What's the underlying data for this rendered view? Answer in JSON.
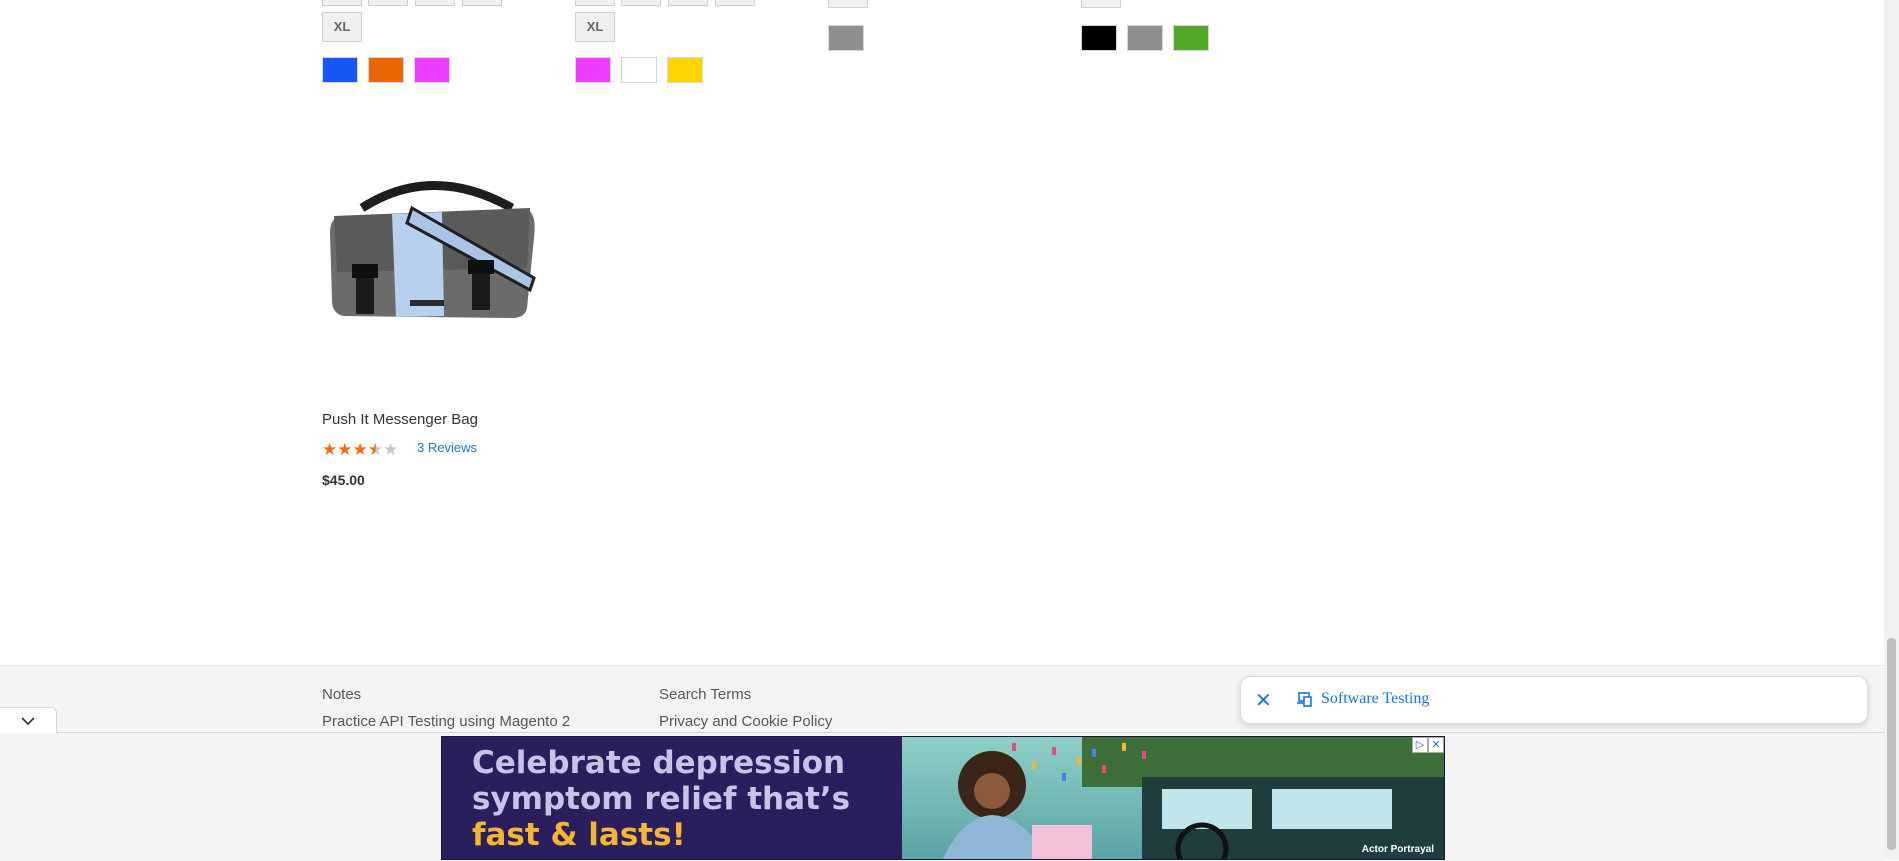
{
  "products_row1": {
    "col1": {
      "size_label": "XL",
      "colors": [
        "#1857f7",
        "#eb6703",
        "#ef3dff"
      ]
    },
    "col2": {
      "size_label": "XL",
      "colors": [
        "#ef3dff",
        "#ffffff",
        "#ffd500"
      ]
    },
    "col3": {
      "colors": [
        "#8f8f8f"
      ]
    },
    "col4": {
      "colors": [
        "#000000",
        "#8f8f8f",
        "#53a828"
      ]
    }
  },
  "product": {
    "name": "Push It Messenger Bag",
    "rating_percent": 67,
    "reviews": "3 Reviews",
    "price": "$45.00"
  },
  "footer": {
    "links_col1": [
      "Notes",
      "Practice API Testing using Magento 2"
    ],
    "links_col2": [
      "Search Terms",
      "Privacy and Cookie Policy"
    ]
  },
  "search_chip": {
    "label": "Software Testing"
  },
  "ad": {
    "line1": "Celebrate depression",
    "line2": "symptom relief that’s",
    "line3": "fast & lasts!",
    "disclaimer": "Actor Portrayal"
  },
  "icons": {
    "chip_close": "close-icon",
    "chip_search": "search-device-icon",
    "collapse": "chevron-down-icon",
    "ad_info": "adchoices-icon",
    "ad_close": "close-icon"
  },
  "colors": {
    "star_on": "#f26c1a",
    "star_off": "#c7c7c7",
    "link": "#1979c3",
    "chip_accent": "#1a73e8",
    "ad_bg": "#2a1f5c",
    "ad_highlight": "#f5b733"
  }
}
